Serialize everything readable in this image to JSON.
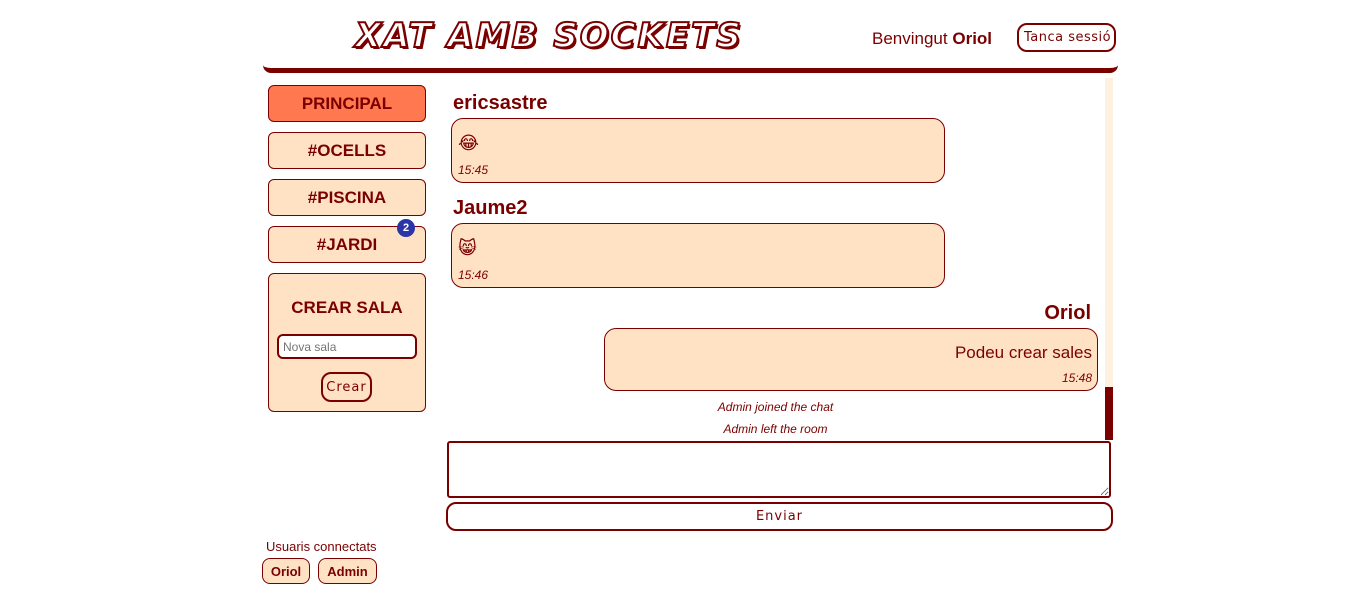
{
  "header": {
    "logo_text": "XAT AMB SOCKETS",
    "welcome_prefix": "Benvingut",
    "username": "Oriol",
    "logout_label": "Tanca sessió"
  },
  "rooms": [
    {
      "label": "PRINCIPAL",
      "active": true
    },
    {
      "label": "#OCELLS"
    },
    {
      "label": "#PISCINA"
    },
    {
      "label": "#JARDI",
      "badge": "2"
    }
  ],
  "create_room": {
    "title": "CREAR SALA",
    "placeholder": "Nova sala",
    "button_label": "Crear"
  },
  "users": {
    "label": "Usuaris connectats",
    "list": [
      "Oriol",
      "Admin"
    ]
  },
  "messages": [
    {
      "author": "ericsastre",
      "content": "😂",
      "time": "15:45"
    },
    {
      "author": "Jaume2",
      "content": "😸",
      "time": "15:46"
    },
    {
      "author": "Oriol",
      "content": "Podeu crear sales",
      "time": "15:48"
    }
  ],
  "system_messages": [
    "Admin joined the chat",
    "Admin left the room"
  ],
  "composer": {
    "send_label": "Enviar"
  },
  "colors": {
    "primary": "#7a0000",
    "bubble": "#ffe2c4",
    "active_room": "#ff7850",
    "badge": "#2b35a8"
  }
}
